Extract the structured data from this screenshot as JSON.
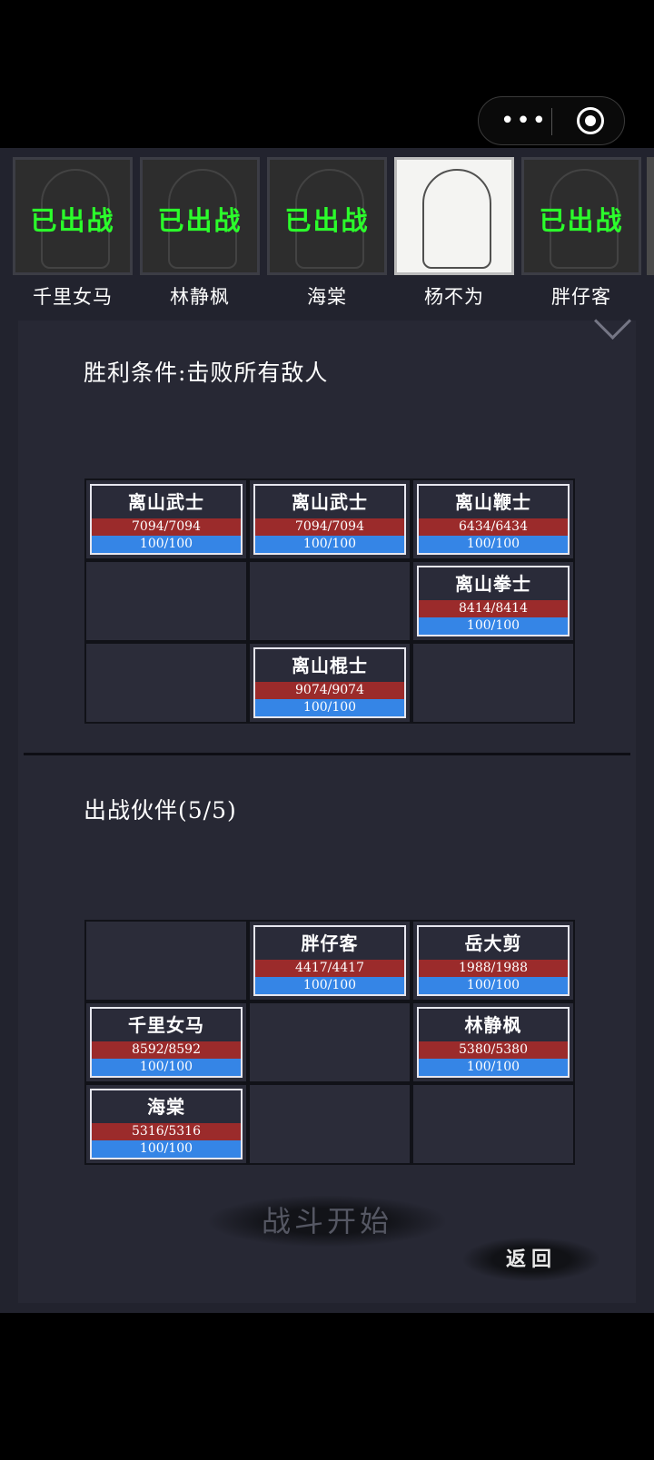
{
  "capsule": {
    "menu_icon": "more-dots-icon",
    "close_icon": "target-circle-icon"
  },
  "roster": [
    {
      "name": "千里女马",
      "status": "已出战",
      "deployed": true
    },
    {
      "name": "林静枫",
      "status": "已出战",
      "deployed": true
    },
    {
      "name": "海棠",
      "status": "已出战",
      "deployed": true
    },
    {
      "name": "杨不为",
      "status": "",
      "deployed": false
    },
    {
      "name": "胖仔客",
      "status": "已出战",
      "deployed": true
    }
  ],
  "victory_condition": "胜利条件:击败所有敌人",
  "enemy_grid": {
    "cards": [
      {
        "name": "离山武士",
        "hp": "7094/7094",
        "mp": "100/100"
      },
      {
        "name": "离山武士",
        "hp": "7094/7094",
        "mp": "100/100"
      },
      {
        "name": "离山鞭士",
        "hp": "6434/6434",
        "mp": "100/100"
      },
      {
        "name": "离山拳士",
        "hp": "8414/8414",
        "mp": "100/100"
      },
      {
        "name": "离山棍士",
        "hp": "9074/9074",
        "mp": "100/100"
      }
    ]
  },
  "partner_title": "出战伙伴(5/5)",
  "partner_grid": {
    "cards": [
      {
        "name": "胖仔客",
        "hp": "4417/4417",
        "mp": "100/100"
      },
      {
        "name": "岳大剪",
        "hp": "1988/1988",
        "mp": "100/100"
      },
      {
        "name": "千里女马",
        "hp": "8592/8592",
        "mp": "100/100"
      },
      {
        "name": "林静枫",
        "hp": "5380/5380",
        "mp": "100/100"
      },
      {
        "name": "海棠",
        "hp": "5316/5316",
        "mp": "100/100"
      }
    ]
  },
  "buttons": {
    "start": "战斗开始",
    "back": "返回"
  },
  "colors": {
    "hp_bar": "#9b2b2b",
    "mp_bar": "#3585e6",
    "deployed_text": "#2bff2b",
    "background": "#22232e"
  }
}
